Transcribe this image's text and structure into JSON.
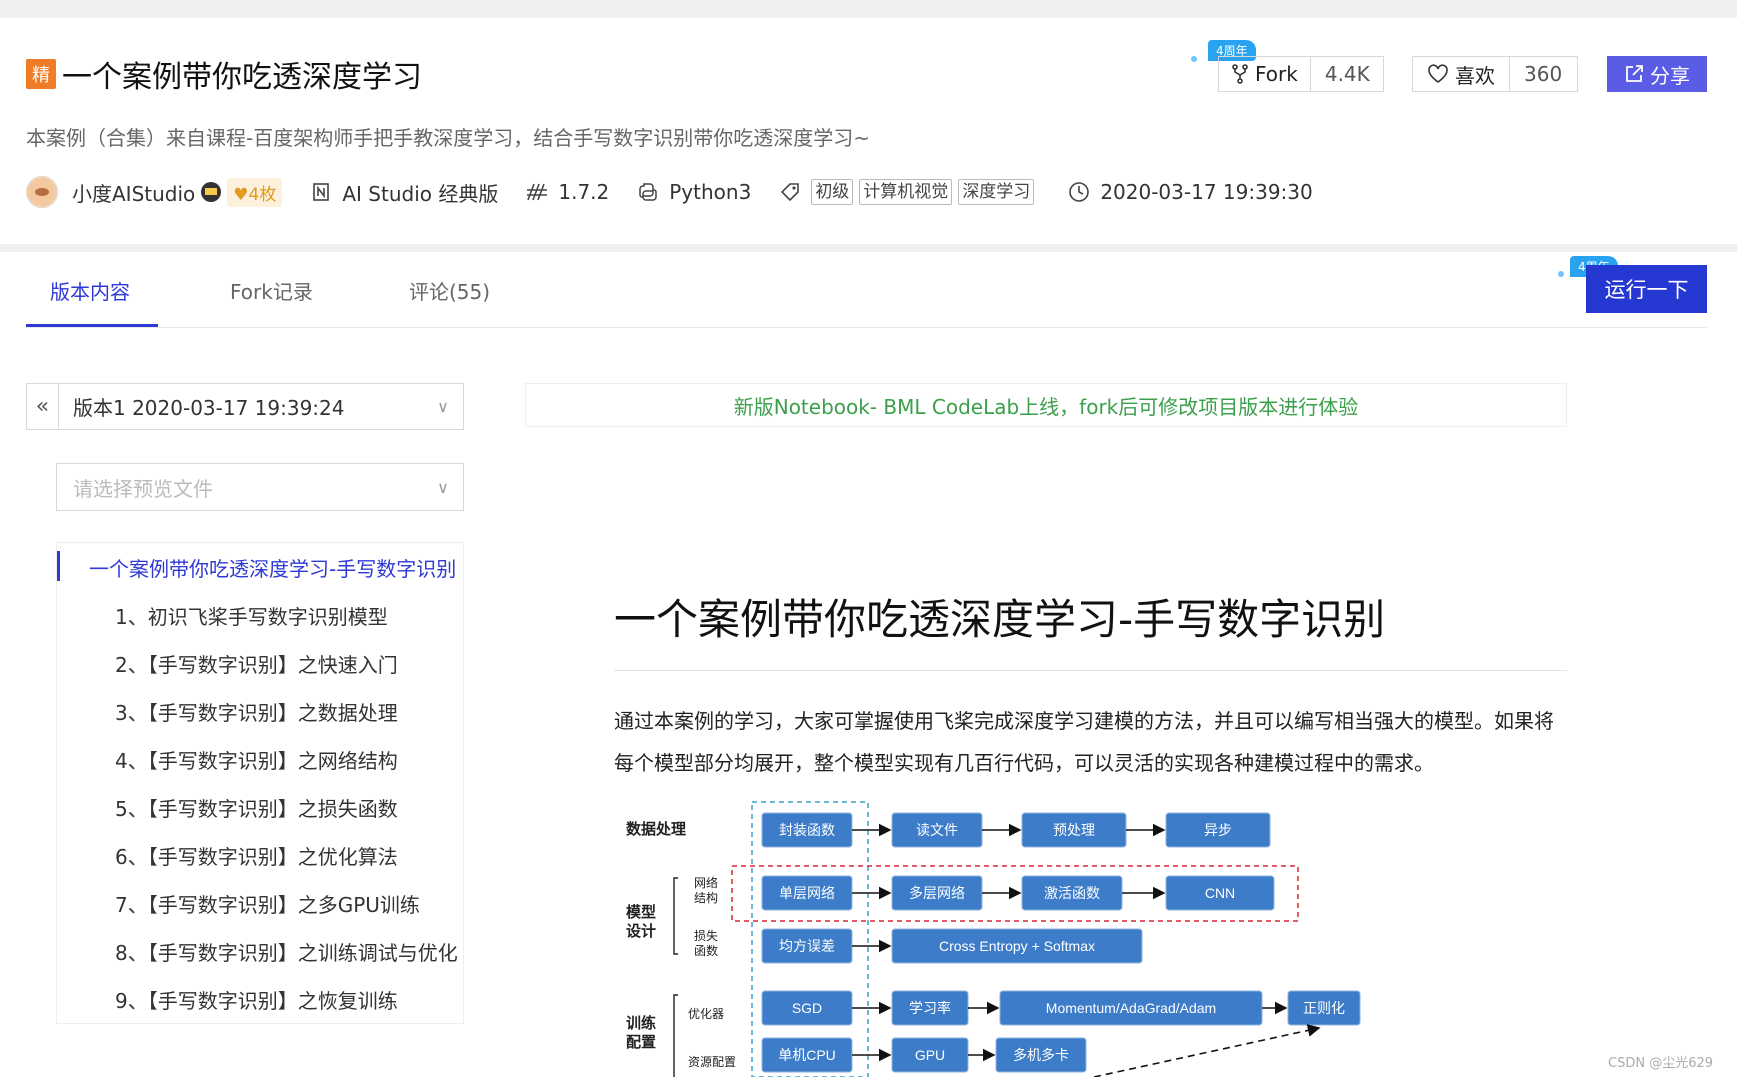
{
  "header": {
    "badge": "精",
    "title": "一个案例带你吃透深度学习",
    "subtitle": "本案例（合集）来自课程-百度架构师手把手教深度学习，结合手写数字识别带你吃透深度学习~",
    "author": "小度AIStudio",
    "medal": "4枚",
    "platform": "AI Studio 经典版",
    "paddle_version": "1.7.2",
    "language": "Python3",
    "tags": [
      "初级",
      "计算机视觉",
      "深度学习"
    ],
    "datetime": "2020-03-17 19:39:30",
    "anniversary": "4周年"
  },
  "actions": {
    "fork_label": "Fork",
    "fork_count": "4.4K",
    "like_label": "喜欢",
    "like_count": "360",
    "share_label": "分享",
    "run_label": "运行一下",
    "anniversary": "4周年"
  },
  "tabs": [
    {
      "label": "版本内容",
      "active": true
    },
    {
      "label": "Fork记录",
      "active": false
    },
    {
      "label": "评论(55)",
      "active": false
    }
  ],
  "sidebar": {
    "version": "版本1 2020-03-17 19:39:24",
    "file_placeholder": "请选择预览文件",
    "toc": [
      "一个案例带你吃透深度学习-手写数字识别",
      "1、初识飞桨手写数字识别模型",
      "2、【手写数字识别】之快速入门",
      "3、【手写数字识别】之数据处理",
      "4、【手写数字识别】之网络结构",
      "5、【手写数字识别】之损失函数",
      "6、【手写数字识别】之优化算法",
      "7、【手写数字识别】之多GPU训练",
      "8、【手写数字识别】之训练调试与优化",
      "9、【手写数字识别】之恢复训练"
    ]
  },
  "notice": "新版Notebook- BML CodeLab上线，fork后可修改项目版本进行体验",
  "notebook": {
    "title": "一个案例带你吃透深度学习-手写数字识别",
    "paragraph": "通过本案例的学习，大家可掌握使用飞桨完成深度学习建模的方法，并且可以编写相当强大的模型。如果将每个模型部分均展开，整个模型实现有几百行代码，可以灵活的实现各种建模过程中的需求。"
  },
  "diagram": {
    "row_labels": [
      "数据处理",
      "模型设计",
      "训练配置"
    ],
    "sub_labels": [
      "网络结构",
      "损失函数",
      "优化器",
      "资源配置"
    ],
    "data_row": [
      "封装函数",
      "读文件",
      "预处理",
      "异步"
    ],
    "net_row": [
      "单层网络",
      "多层网络",
      "激活函数",
      "CNN"
    ],
    "loss_row": [
      "均方误差",
      "Cross Entropy + Softmax"
    ],
    "opt_row": [
      "SGD",
      "学习率",
      "Momentum/AdaGrad/Adam",
      "正则化"
    ],
    "res_row": [
      "单机CPU",
      "GPU",
      "多机多卡"
    ]
  },
  "watermark": "CSDN @尘光629",
  "colors": {
    "accent": "#2f3ad6",
    "share": "#5b5ce6",
    "run": "#2538d1",
    "notice_text": "#3ba04b",
    "box_fill": "#3d7cc9",
    "badge": "#f07c27"
  }
}
